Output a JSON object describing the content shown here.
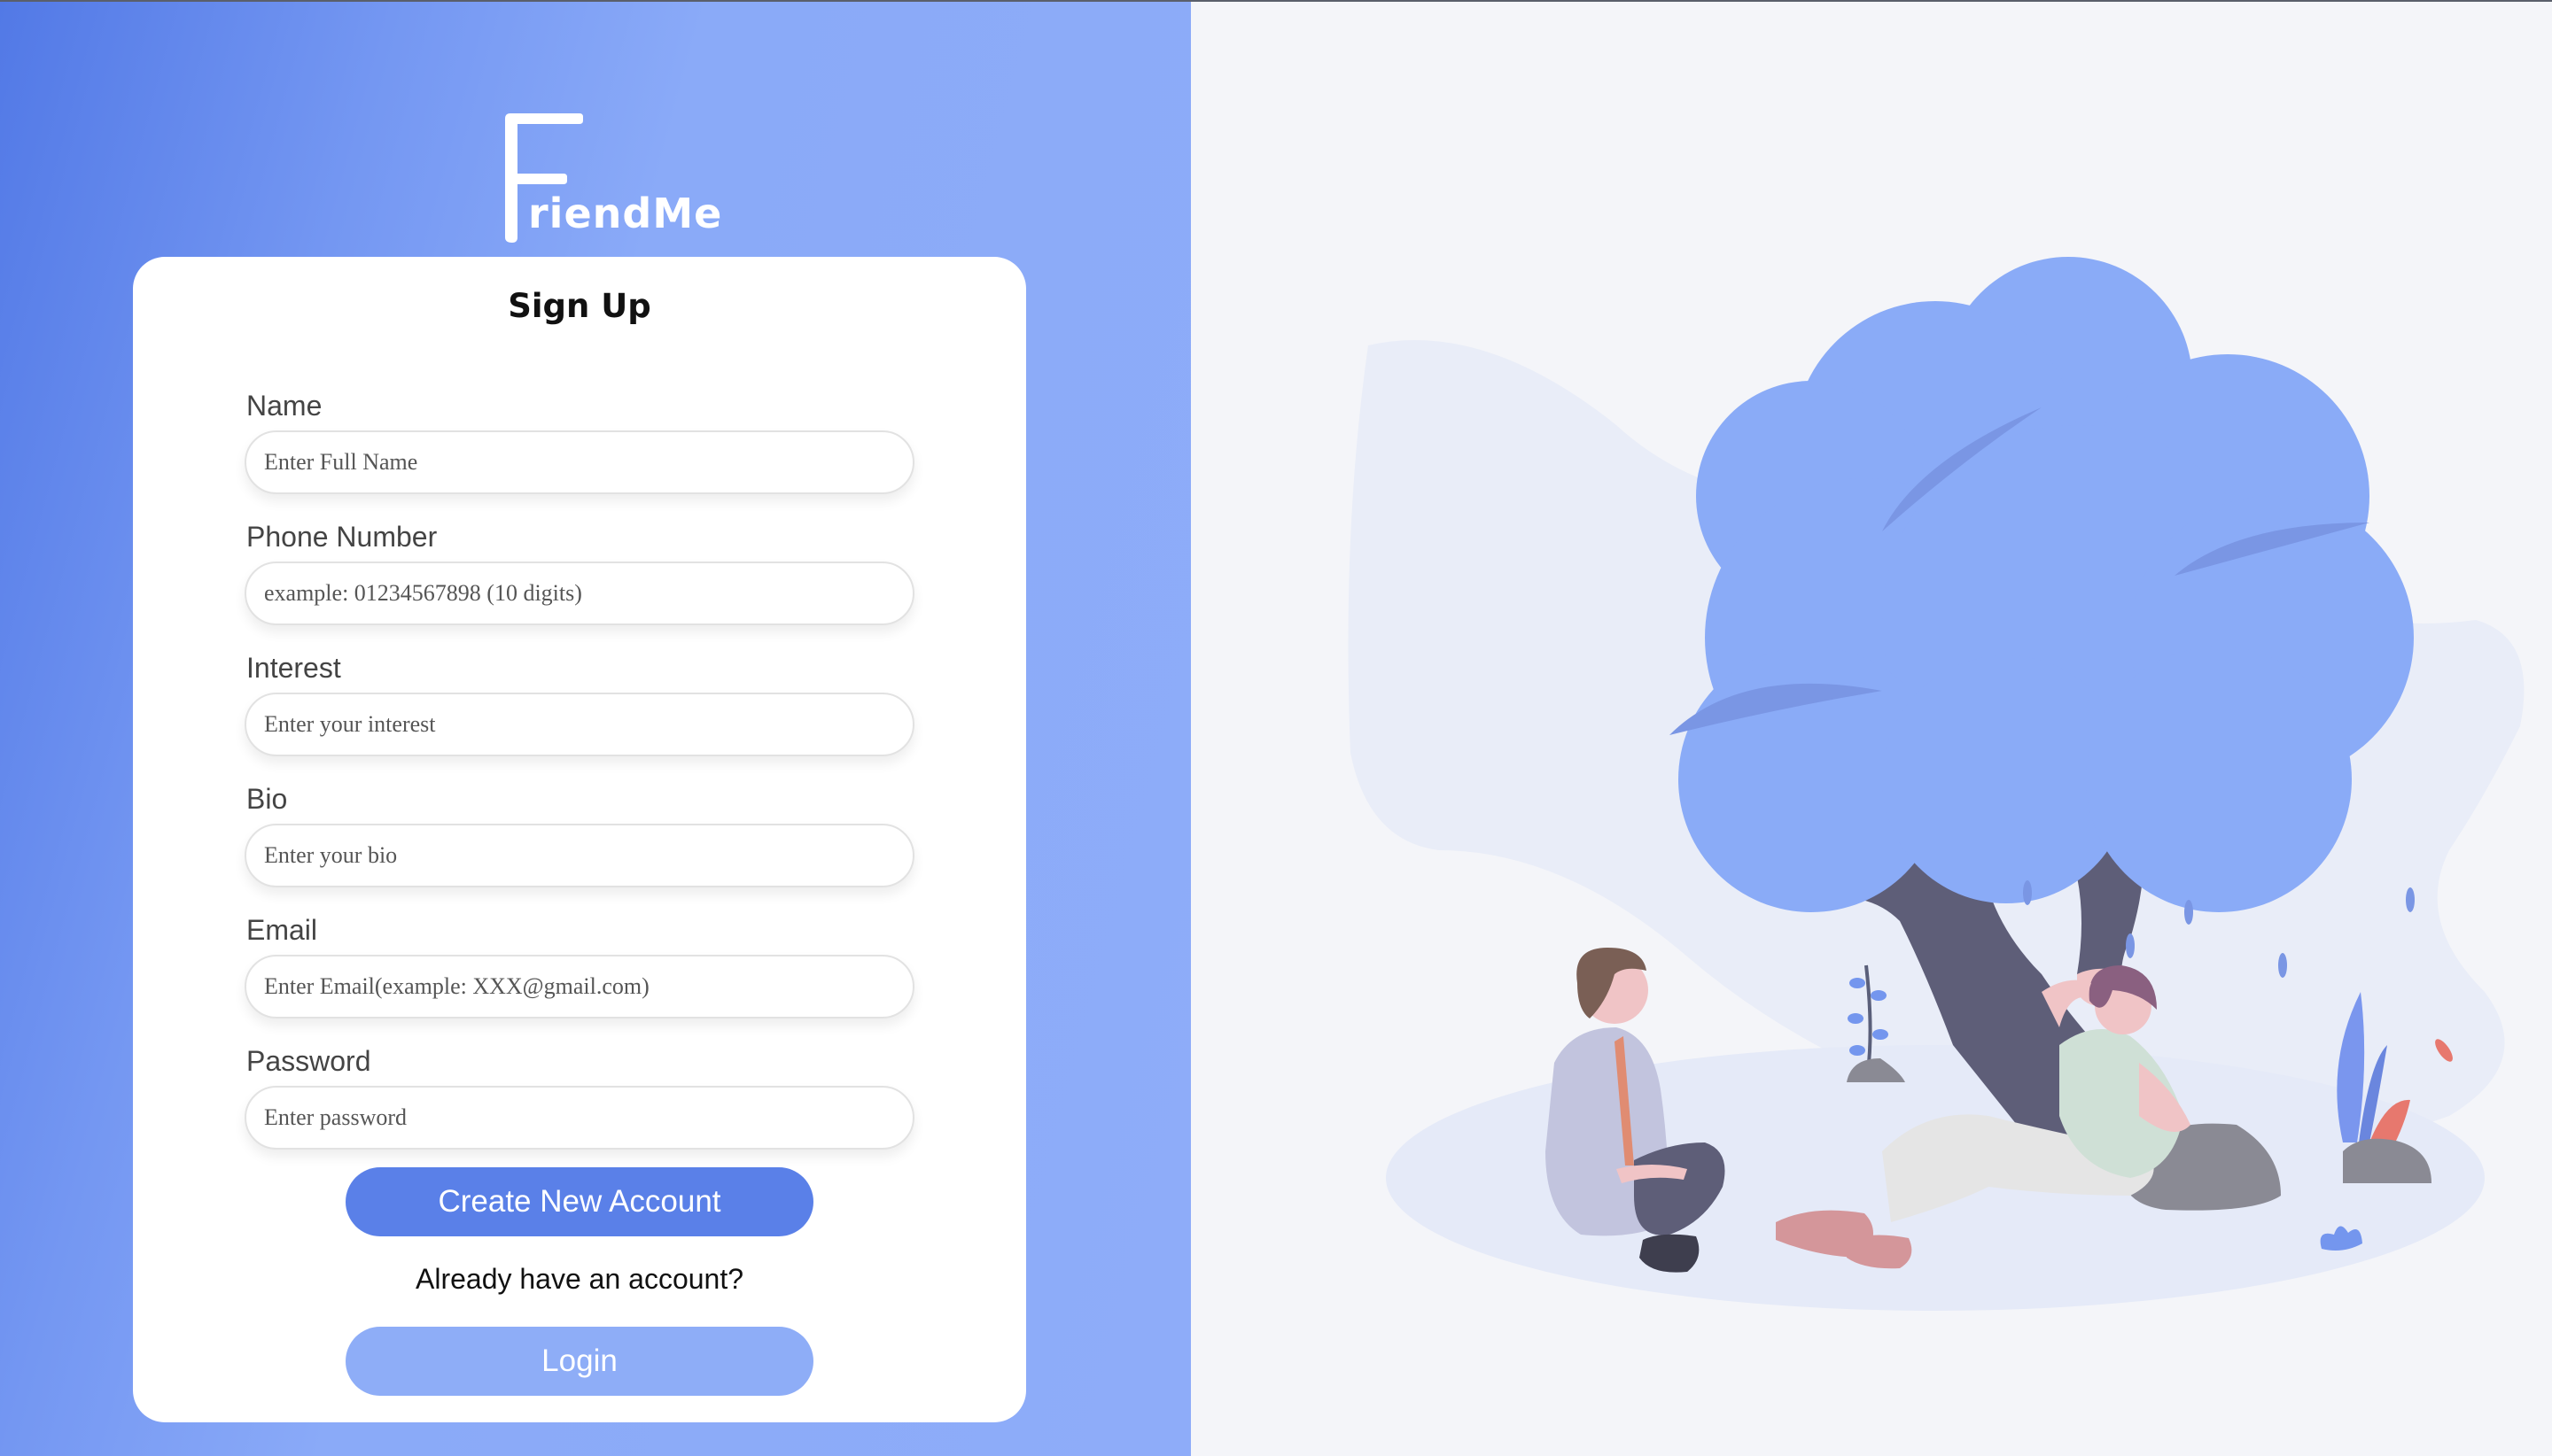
{
  "app": {
    "name": "FriendMe",
    "logo_letter": "F",
    "logo_rest": "riendMe"
  },
  "form": {
    "title": "Sign Up",
    "fields": [
      {
        "label": "Name",
        "placeholder": "Enter Full Name"
      },
      {
        "label": "Phone Number",
        "placeholder": "example: 01234567898 (10 digits)"
      },
      {
        "label": "Interest",
        "placeholder": "Enter your interest"
      },
      {
        "label": "Bio",
        "placeholder": "Enter your bio"
      },
      {
        "label": "Email",
        "placeholder": "Enter Email(example: XXX@gmail.com)"
      },
      {
        "label": "Password",
        "placeholder": "Enter password"
      }
    ],
    "create_button": "Create New Account",
    "already_text": "Already have an account?",
    "login_button": "Login"
  },
  "colors": {
    "primary": "#5a80e8",
    "secondary": "#8eadf7",
    "tree": "#8aabf7",
    "background": "#f4f5f9"
  },
  "illustration": {
    "name": "friends-under-tree"
  }
}
